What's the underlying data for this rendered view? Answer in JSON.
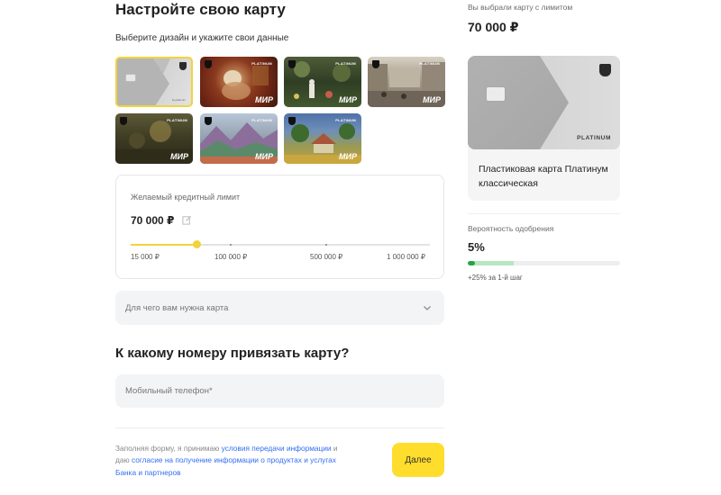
{
  "form": {
    "title": "Настройте свою карту",
    "subtitle": "Выберите дизайн и укажите свои данные"
  },
  "designs": [
    {
      "id": "silver",
      "selected": true,
      "has_mir": false,
      "signature": "by.platinum"
    },
    {
      "id": "lion-painting",
      "selected": false,
      "has_mir": true,
      "label": "PLATINUM",
      "mir": "МИР"
    },
    {
      "id": "lady-garden",
      "selected": false,
      "has_mir": true,
      "label": "PLATINUM",
      "mir": "МИР"
    },
    {
      "id": "city-street",
      "selected": false,
      "has_mir": true,
      "label": "PLATINUM",
      "mir": "МИР"
    },
    {
      "id": "dark-landscape",
      "selected": false,
      "has_mir": true,
      "label": "PLATINUM",
      "mir": "МИР"
    },
    {
      "id": "mountains",
      "selected": false,
      "has_mir": true,
      "label": "PLATINUM",
      "mir": "МИР"
    },
    {
      "id": "village",
      "selected": false,
      "has_mir": true,
      "label": "PLATINUM",
      "mir": "МИР"
    }
  ],
  "limit": {
    "label": "Желаемый кредитный лимит",
    "value": "70 000 ₽",
    "fraction": 0.22,
    "ticks": [
      "15 000 ₽",
      "100 000 ₽",
      "500 000 ₽",
      "1 000 000 ₽"
    ]
  },
  "purpose": {
    "placeholder": "Для чего вам нужна карта"
  },
  "phone_section": {
    "title": "К какому номеру привязать карту?",
    "placeholder": "Мобильный телефон*"
  },
  "consent": {
    "text1": "Заполняя форму, я принимаю ",
    "link1": "условия передачи информации",
    "text2": " и даю ",
    "link2": "согласие на получение информации о продуктах и услугах Банка и партнеров"
  },
  "next_label": "Далее",
  "summary": {
    "chosen_label": "Вы выбрали карту с лимитом",
    "chosen_value": "70 000 ₽",
    "card_label": "PLATINUM",
    "card_name": "Пластиковая карта Платинум классическая",
    "prob_label": "Вероятность одобрения",
    "prob_value": "5%",
    "prob_fraction": 0.05,
    "prob_potential_fraction": 0.25,
    "prob_note": "+25% за 1-й шаг"
  },
  "colors": {
    "accent": "#ffdd2d",
    "link": "#336fee",
    "prob_green": "#23a546",
    "prob_light_green": "#b7e6c1"
  }
}
